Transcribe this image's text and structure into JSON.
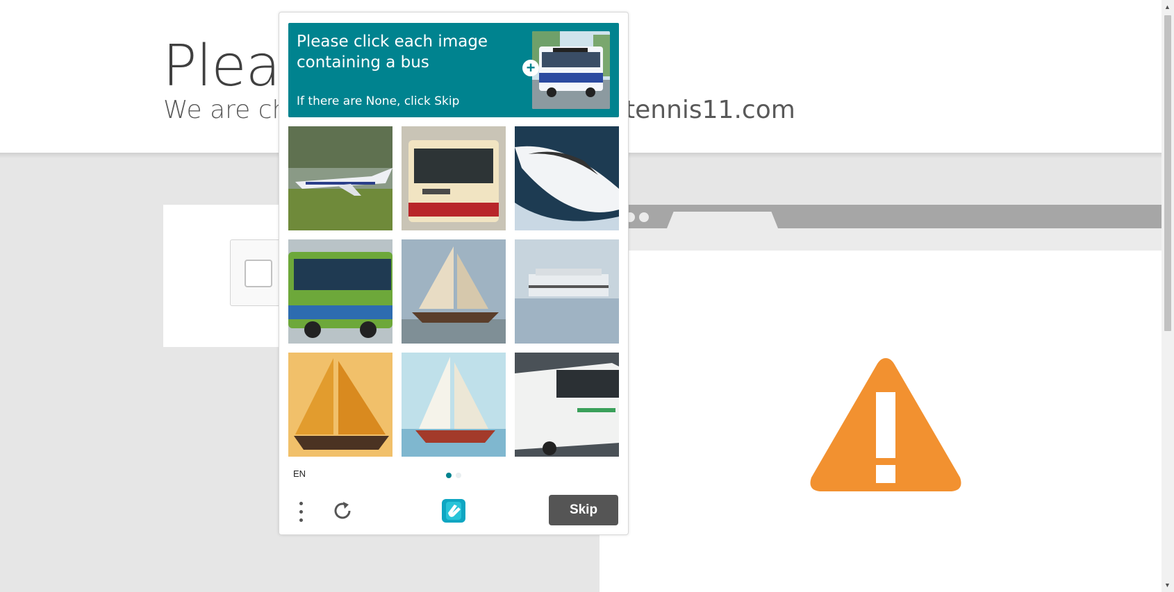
{
  "page": {
    "heading": "Please",
    "subheading_start": "We are che",
    "subheading_end": "tennis11.com"
  },
  "captcha": {
    "prompt": "Please click each image containing a bus",
    "hint": "If there are None, click Skip",
    "language": "EN",
    "skip_label": "Skip",
    "pages_total": 2,
    "page_current": 1,
    "tiles": [
      {
        "subject": "private jet"
      },
      {
        "subject": "double-decker style red bus"
      },
      {
        "subject": "speedboat"
      },
      {
        "subject": "green coach bus"
      },
      {
        "subject": "sailing schooner"
      },
      {
        "subject": "cruise ship"
      },
      {
        "subject": "orange-sail sailboat"
      },
      {
        "subject": "white sailboat"
      },
      {
        "subject": "white city bus"
      }
    ]
  },
  "colors": {
    "prompt_bg": "#00838f",
    "skip_bg": "#555555",
    "warning": "#f29130"
  },
  "icons": [
    "plus-icon",
    "menu-dots-icon",
    "refresh-icon",
    "hcaptcha-logo-icon",
    "warning-icon"
  ]
}
